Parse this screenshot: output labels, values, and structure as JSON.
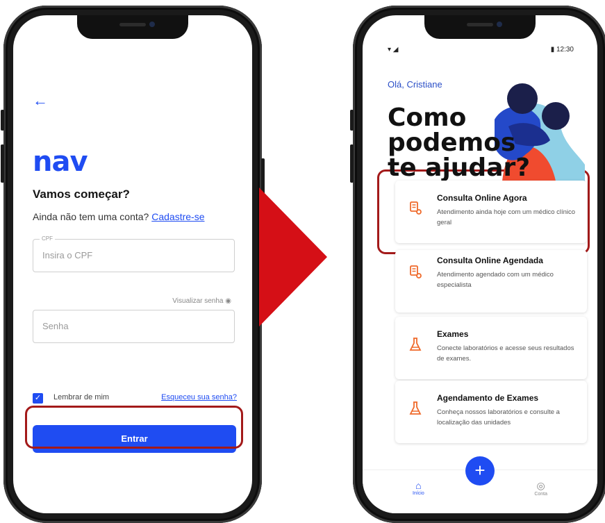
{
  "login_screen": {
    "back": "←",
    "logo": "nav",
    "heading": "Vamos começar?",
    "signup_prompt": "Ainda não tem uma conta?",
    "signup_link": "Cadastre-se",
    "cpf_label": "CPF",
    "cpf_placeholder": "Insira o CPF",
    "show_password": "Visualizar senha ◉",
    "password_placeholder": "Senha",
    "remember_label": "Lembrar de mim",
    "remember_checked": true,
    "forgot_link": "Esqueceu sua senha?",
    "enter_button": "Entrar"
  },
  "home_screen": {
    "status_left": "▾ ◢",
    "status_time": "▮ 12:30",
    "greeting": "Olá, Cristiane",
    "hero_lines": [
      "Como",
      "podemos",
      "te ajudar?"
    ],
    "cards": [
      {
        "title": "Consulta Online Agora",
        "description": "Atendimento ainda hoje com um médico clínico geral",
        "icon": "stethoscope-icon"
      },
      {
        "title": "Consulta Online Agendada",
        "description": "Atendimento agendado com um médico especialista",
        "icon": "stethoscope-icon"
      },
      {
        "title": "Exames",
        "description": "Conecte laboratórios e acesse seus resultados de exames.",
        "icon": "flask-icon"
      },
      {
        "title": "Agendamento de Exames",
        "description": "Conheça nossos laboratórios e consulte a localização das unidades",
        "icon": "flask-icon"
      }
    ],
    "nav_home": "Início",
    "nav_help": "Conta",
    "fab": "+"
  },
  "colors": {
    "brand_blue": "#1f4cf2",
    "highlight_red": "#a31a1a",
    "arrow_red": "#d50f16",
    "icon_orange": "#ef6a2b"
  }
}
